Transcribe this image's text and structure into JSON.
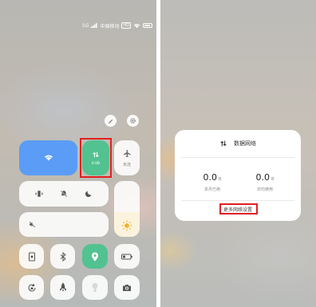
{
  "status_bar": {
    "carrier": "中国移动",
    "signal": "5G",
    "badge": "HD"
  },
  "control_center": {
    "wifi_tile": {
      "icon": "wifi-icon",
      "active": true
    },
    "mobile_data_tile": {
      "icon": "mobile-data-arrows-icon",
      "value": "0.0B",
      "active": true
    },
    "airplane_tile": {
      "icon": "airplane-icon",
      "label": "未连"
    },
    "quick_toggles": [
      "vibrate-icon",
      "mute-bell-icon",
      "do-not-disturb-moon-icon"
    ],
    "volume": {
      "icon": "speaker-muted-icon",
      "level": 0.0
    },
    "brightness": {
      "icon": "sun-icon",
      "level": 0.45
    },
    "row3": [
      "screen-recorder-icon",
      "bluetooth-icon",
      "location-icon",
      "battery-saver-icon"
    ],
    "row4": [
      "rotation-lock-icon",
      "rocket-icon",
      "flashlight-icon",
      "camera-icon"
    ],
    "colors": {
      "accent_blue": "#5b9cf6",
      "accent_green": "#52c290",
      "highlight_red": "#e02020"
    }
  },
  "data_dialog": {
    "title": "数据网络",
    "month_used_value": "0.0",
    "month_used_unit": "B",
    "month_used_label": "本月已用",
    "today_used_value": "0.0",
    "today_used_unit": "B",
    "today_used_label": "日均使用",
    "more_settings": "更多网络设置"
  }
}
